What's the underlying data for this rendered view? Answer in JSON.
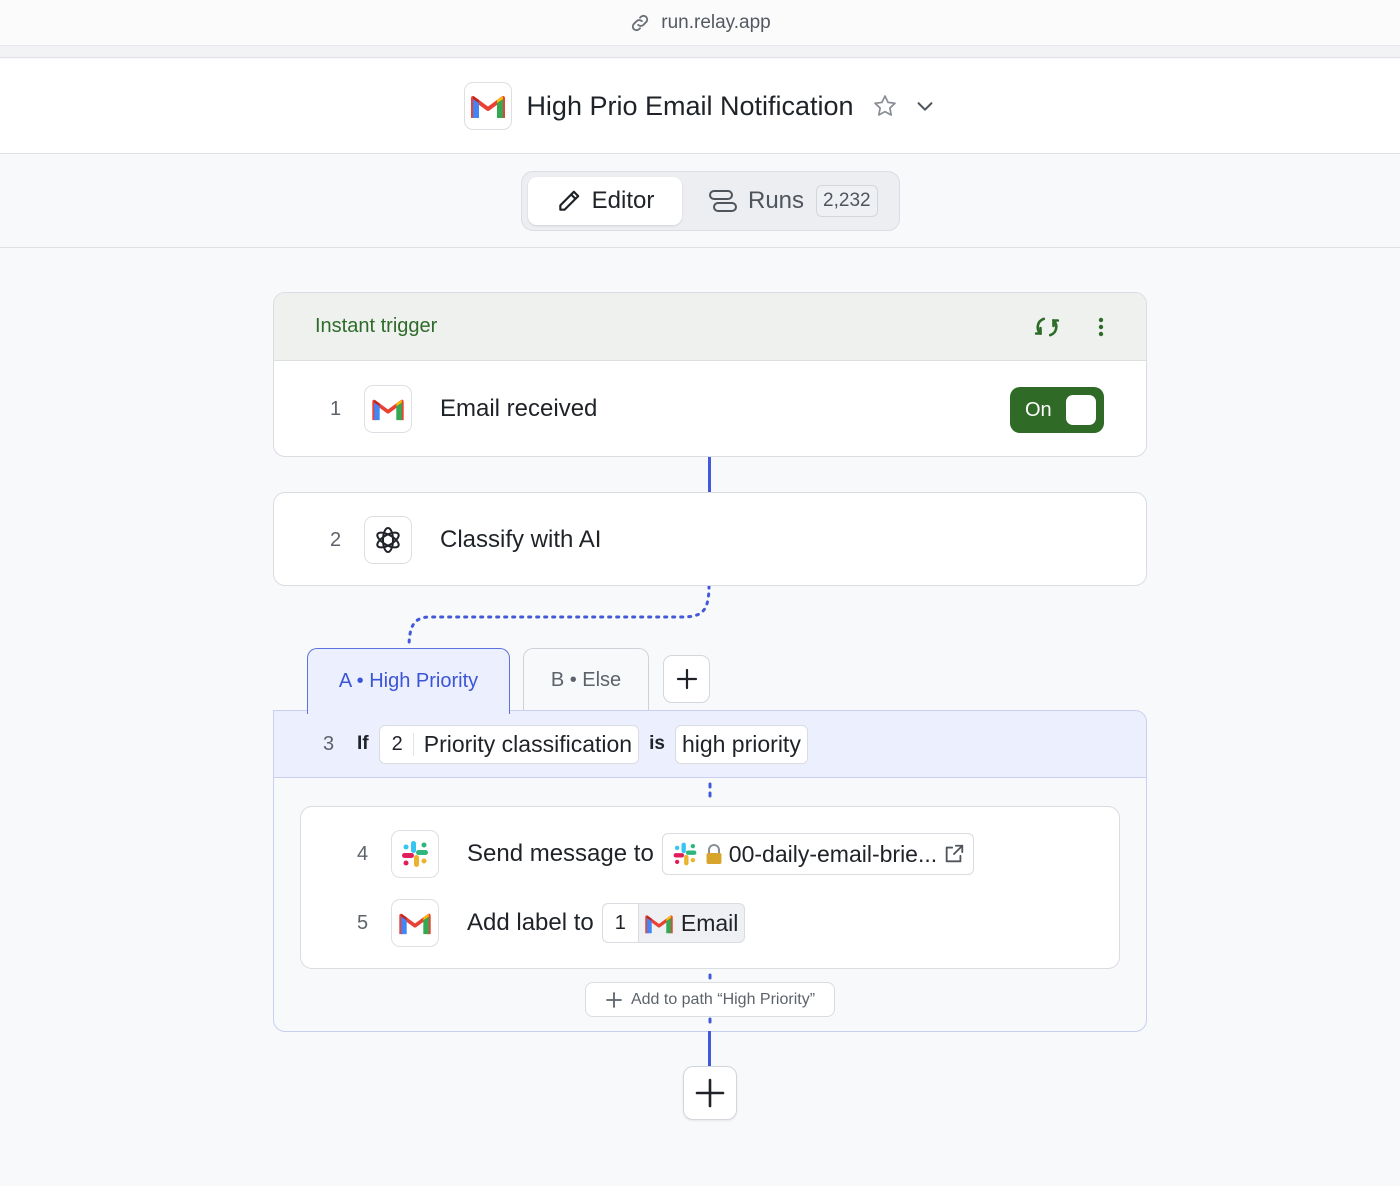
{
  "browser": {
    "url": "run.relay.app"
  },
  "header": {
    "title": "High Prio Email Notification"
  },
  "tabs": {
    "editor_label": "Editor",
    "runs_label": "Runs",
    "runs_count": "2,232"
  },
  "trigger": {
    "section_label": "Instant trigger",
    "toggle_label": "On"
  },
  "steps": [
    {
      "num": "1",
      "label": "Email received",
      "icon": "gmail-icon"
    },
    {
      "num": "2",
      "label": "Classify with AI",
      "icon": "openai-icon"
    }
  ],
  "paths": {
    "tab_a": "A • High Priority",
    "tab_b": "B • Else"
  },
  "condition": {
    "num": "3",
    "if_label": "If",
    "field_step": "2",
    "field_label": "Priority classification",
    "operator": "is",
    "value": "high priority"
  },
  "inner_steps": {
    "step4": {
      "num": "4",
      "label": "Send message to",
      "channel": "00-daily-email-brie..."
    },
    "step5": {
      "num": "5",
      "label": "Add label to",
      "ref_step": "1",
      "ref_label": "Email"
    }
  },
  "add_to_path_label": "Add to path “High Priority”",
  "colors": {
    "accent_blue": "#4259d9",
    "trigger_green": "#2f6a27"
  }
}
